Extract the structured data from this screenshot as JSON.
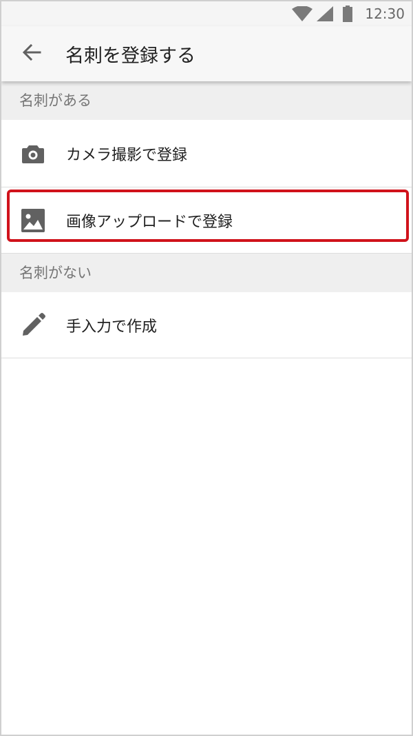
{
  "status_bar": {
    "time": "12:30",
    "icons": [
      "wifi-icon",
      "cellular-signal-icon",
      "battery-icon"
    ]
  },
  "app_bar": {
    "back_icon": "arrow-left-icon",
    "title": "名刺を登録する"
  },
  "sections": [
    {
      "header": "名刺がある",
      "items": [
        {
          "label": "カメラ撮影で登録",
          "icon": "camera-icon"
        },
        {
          "label": "画像アップロードで登録",
          "icon": "image-icon",
          "highlighted": true
        }
      ]
    },
    {
      "header": "名刺がない",
      "items": [
        {
          "label": "手入力で作成",
          "icon": "pencil-icon"
        }
      ]
    }
  ],
  "colors": {
    "highlight": "#d0121b",
    "section_header_bg": "#efefef",
    "icon": "#616161",
    "text_primary": "#212121",
    "text_secondary": "#757575"
  }
}
